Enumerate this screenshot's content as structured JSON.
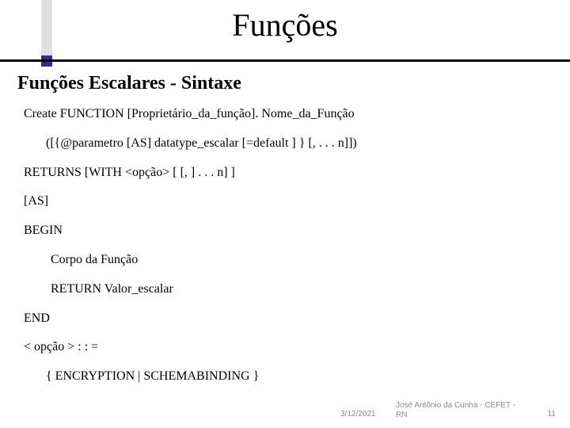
{
  "title": "Funções",
  "subtitle": "Funções Escalares - Sintaxe",
  "lines": {
    "l1": "Create FUNCTION [Proprietário_da_função]. Nome_da_Função",
    "l2": "([{@parametro [AS] datatype_escalar [=default ] } [, . . . n]])",
    "l3": "RETURNS [WITH <opção> [ [, ] . . . n] ]",
    "l4": "[AS]",
    "l5": "BEGIN",
    "l6": "Corpo da Função",
    "l7": "RETURN Valor_escalar",
    "l8": "END",
    "l9": "< opção > : : =",
    "l10": "{ ENCRYPTION | SCHEMABINDING }"
  },
  "footer": {
    "date": "3/12/2021",
    "author": "José Antônio da Cunha - CEFET - RN",
    "page": "11"
  }
}
